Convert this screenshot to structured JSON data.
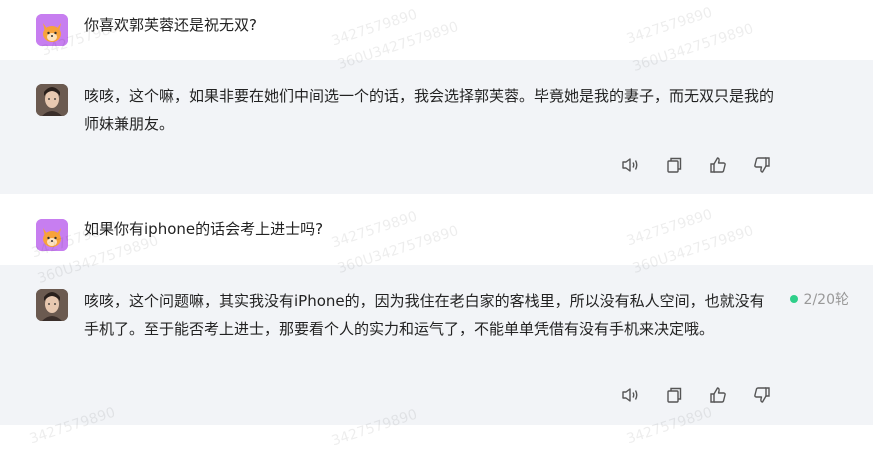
{
  "messages": [
    {
      "role": "user",
      "text": "你喜欢郭芙蓉还是祝无双?"
    },
    {
      "role": "assistant",
      "text": "咳咳，这个嘛，如果非要在她们中间选一个的话，我会选择郭芙蓉。毕竟她是我的妻子，而无双只是我的师妹兼朋友。"
    },
    {
      "role": "user",
      "text": "如果你有iphone的话会考上进士吗?"
    },
    {
      "role": "assistant",
      "text": "咳咳，这个问题嘛，其实我没有iPhone的，因为我住在老白家的客栈里，所以没有私人空间，也就没有手机了。至于能否考上进士，那要看个人的实力和运气了，不能单单凭借有没有手机来决定哦。"
    }
  ],
  "turn_counter": "2/20轮",
  "watermark_texts": [
    "3427579890",
    "360U3427579890"
  ],
  "icons": {
    "actions": [
      "speaker-icon",
      "copy-icon",
      "thumbs-up-icon",
      "thumbs-down-icon"
    ],
    "user_avatar": "fox-avatar",
    "bot_avatar": "character-portrait-avatar"
  },
  "colors": {
    "assistant_background": "#f2f4f7",
    "user_avatar_bg": "#c77ef0",
    "status_dot": "#2fcf8a",
    "icon_stroke": "#555555"
  }
}
